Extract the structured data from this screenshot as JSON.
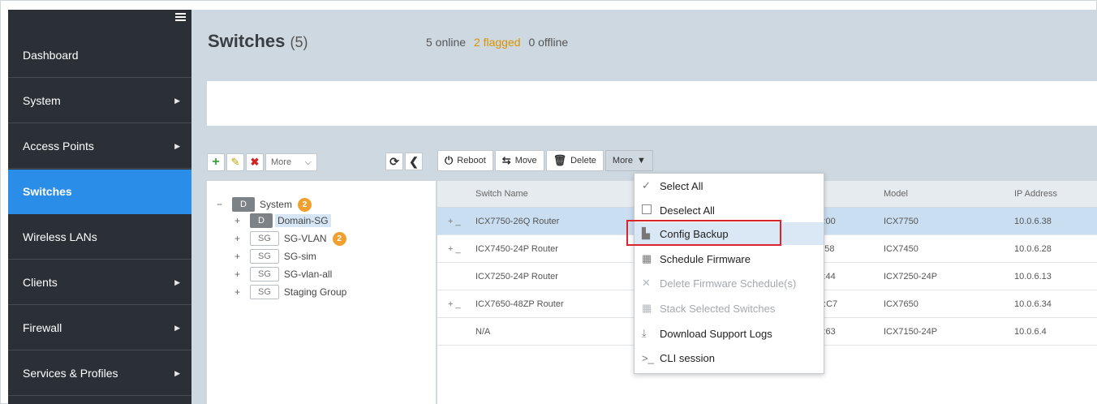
{
  "sidebar": {
    "items": [
      {
        "label": "Dashboard",
        "arrow": false,
        "active": false
      },
      {
        "label": "System",
        "arrow": true,
        "active": false
      },
      {
        "label": "Access Points",
        "arrow": true,
        "active": false
      },
      {
        "label": "Switches",
        "arrow": false,
        "active": true
      },
      {
        "label": "Wireless LANs",
        "arrow": false,
        "active": false
      },
      {
        "label": "Clients",
        "arrow": true,
        "active": false
      },
      {
        "label": "Firewall",
        "arrow": true,
        "active": false
      },
      {
        "label": "Services & Profiles",
        "arrow": true,
        "active": false
      }
    ],
    "arrow_glyph": "▶"
  },
  "header": {
    "title": "Switches",
    "count": "(5)",
    "online": "5 online",
    "flagged": "2 flagged",
    "offline": "0 offline"
  },
  "tree_toolbar": {
    "add": "+",
    "edit": "✎",
    "delete": "✖",
    "more": "More",
    "refresh": "⟳",
    "collapse": "❮"
  },
  "tree": {
    "system": {
      "toggle": "−",
      "tag": "D",
      "label": "System",
      "badge": "2"
    },
    "domain": {
      "toggle": "+",
      "tag": "D",
      "label": "Domain-SG"
    },
    "groups": [
      {
        "toggle": "+",
        "tag": "SG",
        "label": "SG-VLAN",
        "badge": "2"
      },
      {
        "toggle": "+",
        "tag": "SG",
        "label": "SG-sim"
      },
      {
        "toggle": "+",
        "tag": "SG",
        "label": "SG-vlan-all"
      },
      {
        "toggle": "+",
        "tag": "SG",
        "label": "Staging Group"
      }
    ]
  },
  "switch_toolbar": {
    "reboot": "Reboot",
    "move": "Move",
    "delete": "Delete",
    "more": "More"
  },
  "table": {
    "columns": [
      "Switch Name",
      "Model",
      "IP Address"
    ],
    "rows": [
      {
        "expand": "+ _",
        "name": "ICX7750-26Q Router",
        "mac": "E1:00",
        "model": "ICX7750",
        "ip": "10.0.6.38",
        "selected": true
      },
      {
        "expand": "+ _",
        "name": "ICX7450-24P Router",
        "mac": "09:58",
        "model": "ICX7450",
        "ip": "10.0.6.28",
        "selected": false
      },
      {
        "expand": "",
        "name": "ICX7250-24P Router",
        "mac": "3B:44",
        "model": "ICX7250-24P",
        "ip": "10.0.6.13",
        "selected": false
      },
      {
        "expand": "+ _",
        "name": "ICX7650-48ZP Router",
        "mac": "C5:C7",
        "model": "ICX7650",
        "ip": "10.0.6.34",
        "selected": false
      },
      {
        "expand": "",
        "name": "N/A",
        "mac": "3E:63",
        "model": "ICX7150-24P",
        "ip": "10.0.6.4",
        "selected": false
      }
    ]
  },
  "more_menu": {
    "items": [
      {
        "label": "Select All",
        "icon": "check-icon",
        "glyph": "✓",
        "disabled": false
      },
      {
        "label": "Deselect All",
        "icon": "checkbox-icon",
        "glyph": "",
        "disabled": false
      },
      {
        "label": "Config Backup",
        "icon": "file-icon",
        "glyph": "▙",
        "disabled": false
      },
      {
        "label": "Schedule Firmware",
        "icon": "calendar-icon",
        "glyph": "▦",
        "disabled": false
      },
      {
        "label": "Delete Firmware Schedule(s)",
        "icon": "x-icon",
        "glyph": "✕",
        "disabled": true
      },
      {
        "label": "Stack Selected Switches",
        "icon": "calendar-icon",
        "glyph": "▦",
        "disabled": true
      },
      {
        "label": "Download Support Logs",
        "icon": "download-icon",
        "glyph": "⤓",
        "disabled": false
      },
      {
        "label": "CLI session",
        "icon": "terminal-icon",
        "glyph": ">_",
        "disabled": false
      }
    ],
    "highlighted": "Config Backup"
  },
  "colors": {
    "sidebar_bg": "#2b3036",
    "active_nav": "#2a8ee8",
    "main_bg": "#cdd8e0",
    "flagged": "#d89300",
    "badge": "#f0a030",
    "highlight_border": "#d9262e"
  }
}
